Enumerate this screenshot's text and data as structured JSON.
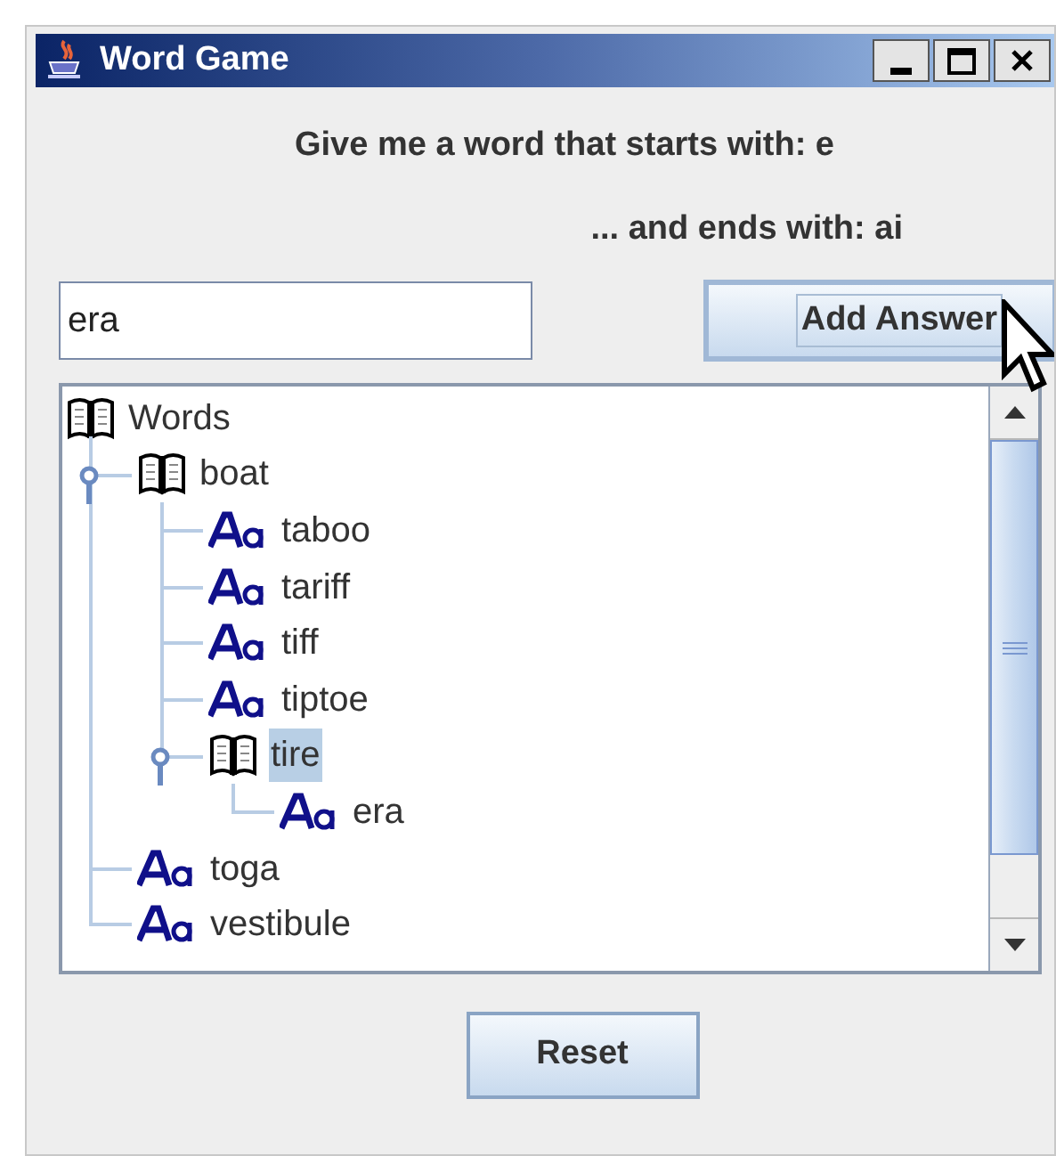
{
  "window": {
    "title": "Word Game"
  },
  "prompt": {
    "line_1": "Give me a word that starts with: e",
    "line_2": "... and ends with: ai"
  },
  "answer_field": {
    "value": "era"
  },
  "add_button": {
    "label": "Add Answer"
  },
  "tree": {
    "label": "Words",
    "kind": "folder",
    "selected": false,
    "children": [
      {
        "label": "boat",
        "kind": "folder",
        "expanded": true,
        "selected": false,
        "children": [
          {
            "label": "taboo",
            "kind": "word",
            "selected": false
          },
          {
            "label": "tariff",
            "kind": "word",
            "selected": false
          },
          {
            "label": "tiff",
            "kind": "word",
            "selected": false
          },
          {
            "label": "tiptoe",
            "kind": "word",
            "selected": false
          },
          {
            "label": "tire",
            "kind": "folder",
            "expanded": true,
            "selected": true,
            "children": [
              {
                "label": "era",
                "kind": "word",
                "selected": false
              }
            ]
          }
        ]
      },
      {
        "label": "toga",
        "kind": "word",
        "selected": false
      },
      {
        "label": "vestibule",
        "kind": "word",
        "selected": false
      }
    ]
  },
  "reset_button": {
    "label": "Reset"
  }
}
